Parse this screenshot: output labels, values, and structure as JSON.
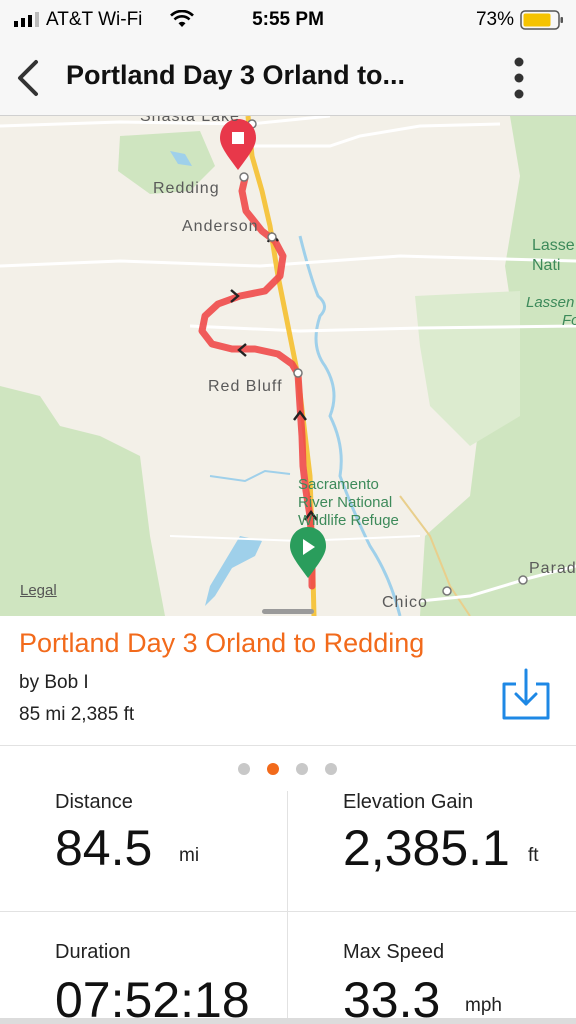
{
  "status_bar": {
    "carrier": "AT&T Wi-Fi",
    "time": "5:55 PM",
    "battery": "73%"
  },
  "nav": {
    "title": "Portland Day 3 Orland  to...",
    "back_icon": "chevron-left-icon",
    "menu_icon": "more-vertical-icon"
  },
  "map": {
    "labels": {
      "shasta_lake": "Shasta Lake",
      "redding": "Redding",
      "anderson": "Anderson",
      "red_bluff": "Red Bluff",
      "chico": "Chico",
      "paradise": "Parad",
      "refuge_1": "Sacramento",
      "refuge_2": "River National",
      "refuge_3": "Wildlife Refuge",
      "lassen_1": "Lasse",
      "lassen_2": "Nati",
      "lassen_forest_1": "Lassen",
      "lassen_forest_2": "Fo"
    },
    "legal": "Legal",
    "colors": {
      "route": "#f04a4a",
      "start_marker": "#2a9d5c",
      "end_marker": "#e8384a",
      "park_green": "#cfe5c0",
      "water": "#9fd0ea",
      "highway": "#f5c542"
    }
  },
  "route": {
    "title": "Portland Day 3 Orland  to Redding",
    "author": "by Bob I",
    "summary": "85 mi 2,385 ft",
    "accent": "#f26a1b",
    "download_icon": "download-icon"
  },
  "pager": {
    "count": 4,
    "active_index": 1
  },
  "stats": [
    {
      "label": "Distance",
      "value": "84.5",
      "unit": "mi"
    },
    {
      "label": "Elevation Gain",
      "value": "2,385.1",
      "unit": "ft"
    },
    {
      "label": "Duration",
      "value": "07:52:18",
      "unit": ""
    },
    {
      "label": "Max Speed",
      "value": "33.3",
      "unit": "mph"
    }
  ]
}
